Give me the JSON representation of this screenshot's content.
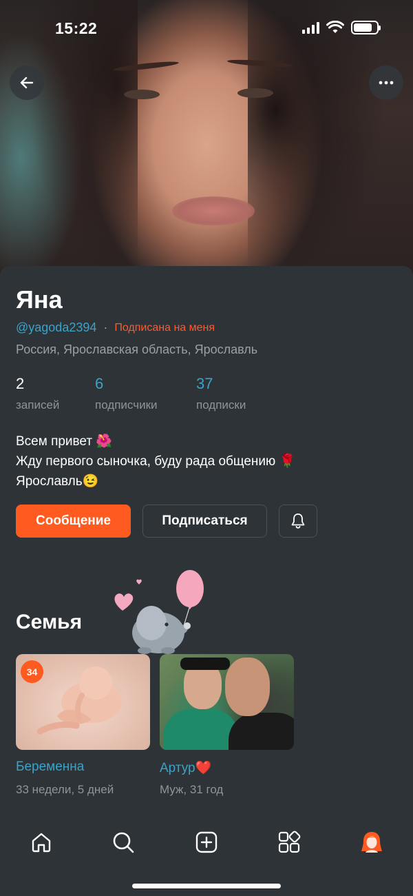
{
  "status_bar": {
    "time": "15:22"
  },
  "header": {
    "back_icon": "arrow-left-icon",
    "more_icon": "ellipsis-icon"
  },
  "profile": {
    "name": "Яна",
    "handle": "@yagoda2394",
    "separator": "·",
    "follows_me": "Подписана на меня",
    "location": "Россия, Ярославская область, Ярославль",
    "stats": [
      {
        "value": "2",
        "label": "записей"
      },
      {
        "value": "6",
        "label": "подписчики"
      },
      {
        "value": "37",
        "label": "подписки"
      }
    ],
    "bio": [
      "Всем привет 🌺",
      "Жду первого сыночка, буду рада общению 🌹",
      "Ярославль😉"
    ],
    "actions": {
      "message": "Сообщение",
      "subscribe": "Подписаться",
      "bell_icon": "bell-icon"
    }
  },
  "family": {
    "title": "Семья",
    "members": [
      {
        "badge": "34",
        "title": "Беременна",
        "subtitle": "33 недели, 5 дней"
      },
      {
        "title": "Артур❤️",
        "subtitle": "Муж, 31 год"
      }
    ]
  },
  "tabbar": {
    "items": [
      "home-icon",
      "search-icon",
      "add-post-icon",
      "apps-icon",
      "profile-avatar-icon"
    ]
  },
  "colors": {
    "accent": "#ff5a1f",
    "link": "#3aa3c7",
    "background": "#2e3338",
    "muted": "#8e949a"
  }
}
